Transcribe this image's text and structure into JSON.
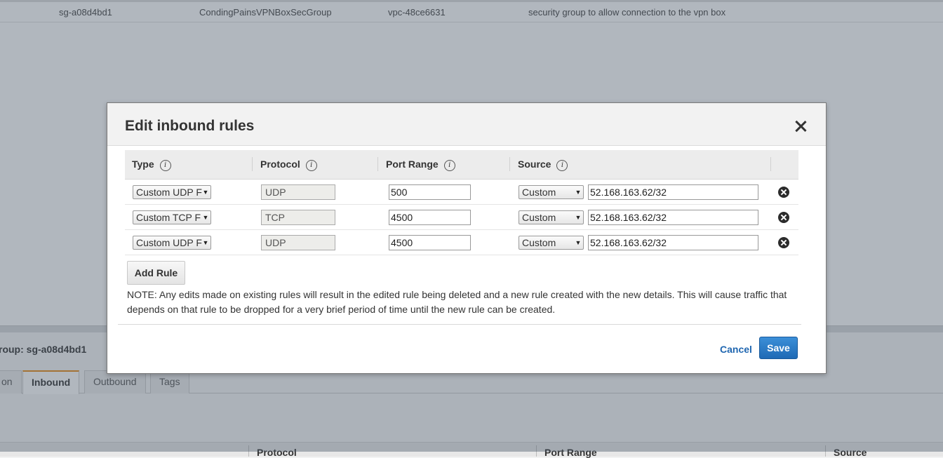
{
  "background": {
    "row": {
      "group_id": "sg-a08d4bd1",
      "group_name": "CondingPainsVPNBoxSecGroup",
      "vpc_id": "vpc-48ce6631",
      "description": "security group to allow connection to the vpn box"
    },
    "detail_title": "roup: sg-a08d4bd1",
    "tabs": [
      "on",
      "Inbound",
      "Outbound",
      "Tags"
    ],
    "active_tab": "Inbound",
    "table_headers": [
      "Protocol",
      "Port Range",
      "Source"
    ]
  },
  "modal": {
    "title": "Edit inbound rules",
    "columns": {
      "type": "Type",
      "protocol": "Protocol",
      "port_range": "Port Range",
      "source": "Source"
    },
    "info_glyph": "i",
    "rules": [
      {
        "type": "Custom UDP F",
        "protocol": "UDP",
        "port_range": "500",
        "source_type": "Custom",
        "source": "52.168.163.62/32"
      },
      {
        "type": "Custom TCP F",
        "protocol": "TCP",
        "port_range": "4500",
        "source_type": "Custom",
        "source": "52.168.163.62/32"
      },
      {
        "type": "Custom UDP F",
        "protocol": "UDP",
        "port_range": "4500",
        "source_type": "Custom",
        "source": "52.168.163.62/32"
      }
    ],
    "add_rule_label": "Add Rule",
    "note": "NOTE: Any edits made on existing rules will result in the edited rule being deleted and a new rule created with the new details. This will cause traffic that depends on that rule to be dropped for a very brief period of time until the new rule can be created.",
    "cancel_label": "Cancel",
    "save_label": "Save"
  },
  "icons": {
    "close": "close-icon",
    "remove": "remove-rule-icon",
    "info": "info-icon",
    "dropdown": "chevron-down-icon"
  },
  "colors": {
    "primary_button": "#1f6ab5",
    "link": "#1f66b0",
    "active_tab_accent": "#e88b15",
    "overlay": "#445465"
  }
}
